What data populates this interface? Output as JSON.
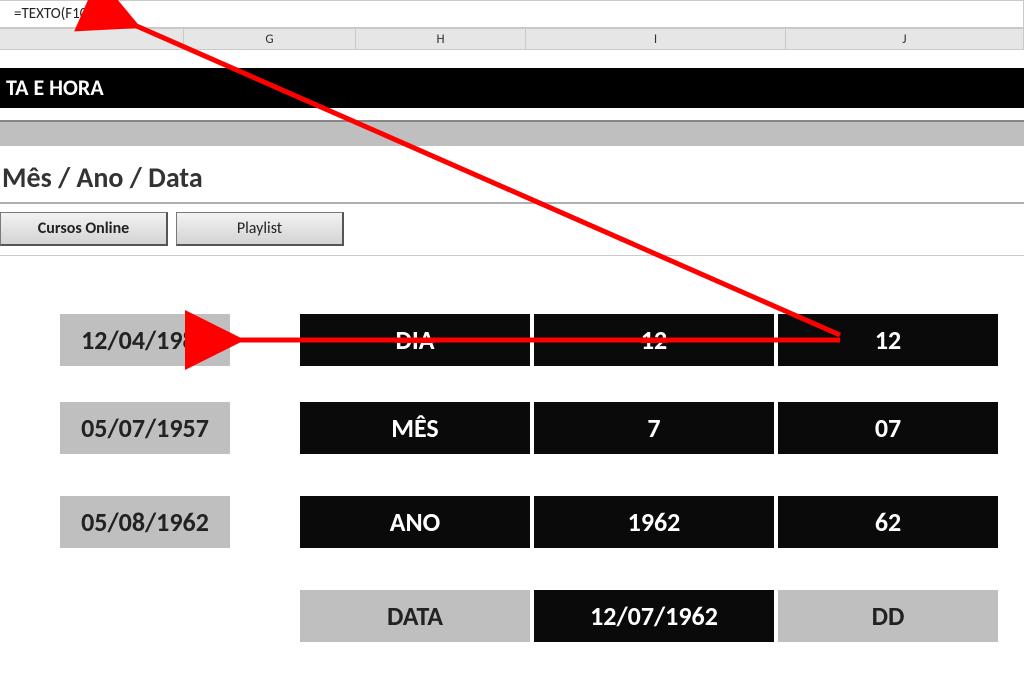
{
  "formula_bar": {
    "formula": "=TEXTO(F10;\"dd\")"
  },
  "columns": {
    "G": "G",
    "H": "H",
    "I": "I",
    "J": "J"
  },
  "black_band": {
    "title": "TA E HORA"
  },
  "section": {
    "title": "Mês / Ano / Data"
  },
  "buttons": {
    "cursos": "Cursos Online",
    "playlist": "Playlist"
  },
  "dates": {
    "d1": "12/04/1982",
    "d2": "05/07/1957",
    "d3": "05/08/1962"
  },
  "rows": {
    "r1": {
      "label": "DIA",
      "val": "12",
      "out": "12"
    },
    "r2": {
      "label": "MÊS",
      "val": "7",
      "out": "07"
    },
    "r3": {
      "label": "ANO",
      "val": "1962",
      "out": "62"
    },
    "r4": {
      "label": "DATA",
      "val": "12/07/1962",
      "out": "DD"
    }
  }
}
